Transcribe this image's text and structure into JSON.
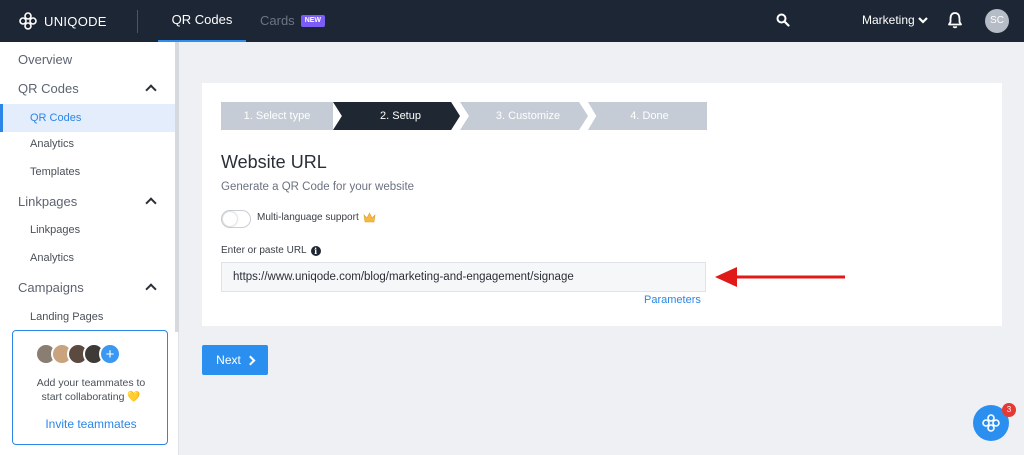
{
  "app": {
    "logo_text": "UNIQODE"
  },
  "nav": {
    "tabs": [
      {
        "label": "QR Codes",
        "active": true
      },
      {
        "label": "Cards",
        "badge": "NEW"
      }
    ],
    "workspace": "Marketing",
    "user_initials": "SC",
    "icons": [
      "search-icon",
      "bell-icon",
      "chevron-down-icon"
    ]
  },
  "sidebar": {
    "items": [
      {
        "label": "Overview"
      },
      {
        "label": "QR Codes",
        "expandable": true
      },
      {
        "label": "QR Codes",
        "sub": true,
        "active": true
      },
      {
        "label": "Analytics",
        "sub": true
      },
      {
        "label": "Templates",
        "sub": true
      },
      {
        "label": "Linkpages",
        "expandable": true
      },
      {
        "label": "Linkpages",
        "sub": true
      },
      {
        "label": "Analytics",
        "sub": true
      },
      {
        "label": "Campaigns",
        "expandable": true
      },
      {
        "label": "Landing Pages",
        "sub": true
      }
    ],
    "team_card": {
      "text_line1": "Add your teammates to",
      "text_line2": "start collaborating",
      "emoji": "💛",
      "invite_label": "Invite teammates"
    }
  },
  "wizard": {
    "steps": [
      "1. Select type",
      "2. Setup",
      "3. Customize",
      "4. Done"
    ],
    "active_step": "2. Setup"
  },
  "form": {
    "title": "Website URL",
    "subtitle": "Generate a QR Code for your website",
    "multilang_label": "Multi-language support",
    "multilang_enabled": false,
    "url_label": "Enter or paste URL",
    "url_value": "https://www.uniqode.com/blog/marketing-and-engagement/signage",
    "parameters_label": "Parameters",
    "next_label": "Next"
  },
  "help": {
    "badge_count": "3"
  },
  "colors": {
    "accent": "#2b8ff0",
    "topbar": "#1d2634",
    "arrow": "#e01919",
    "active_step": "#1f2733"
  }
}
